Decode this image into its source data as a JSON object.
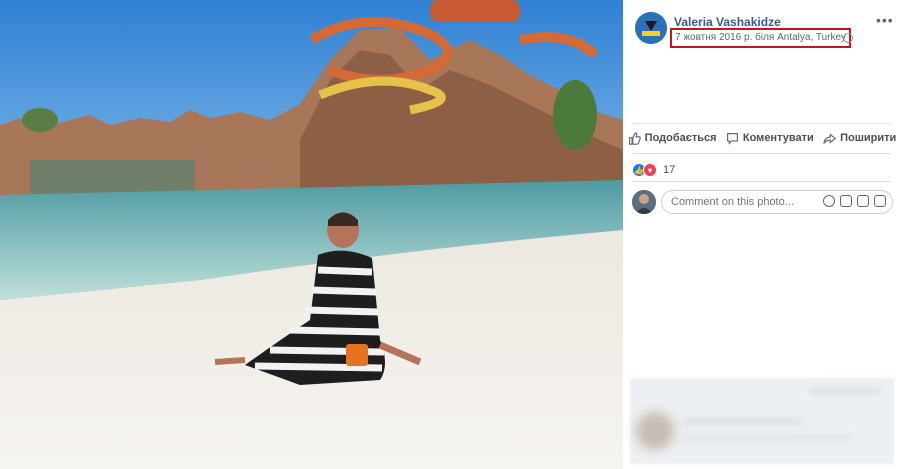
{
  "post": {
    "author": "Valeria Vashakidze",
    "date_location": "7 жовтня 2016 р. біля Antalya, Turkey",
    "more_label": "•••"
  },
  "actions": {
    "like": "Подобається",
    "comment": "Коментувати",
    "share": "Поширити"
  },
  "reactions": {
    "count": "17"
  },
  "comment": {
    "placeholder": "Comment on this photo..."
  },
  "icons": [
    "thumb-up-icon",
    "comment-bubble-icon",
    "share-arrow-icon",
    "like-reaction-icon",
    "love-reaction-icon",
    "emoji-icon",
    "camera-icon",
    "gif-icon",
    "sticker-icon",
    "globe-icon"
  ],
  "colors": {
    "link": "#365899",
    "highlight_border": "#c4161c",
    "like": "#1877f2",
    "love": "#f33e58"
  }
}
